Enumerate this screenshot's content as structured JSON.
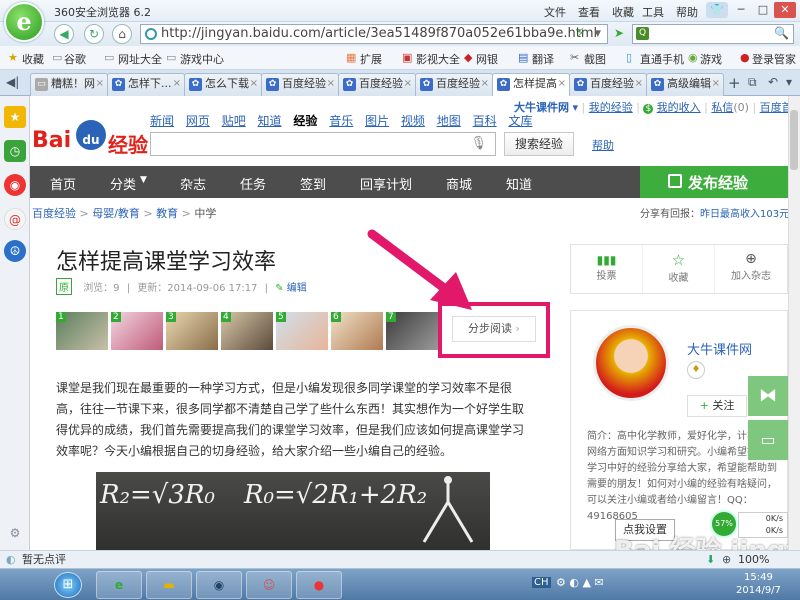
{
  "browser": {
    "title": "360安全浏览器 6.2",
    "menus": [
      "文件",
      "查看",
      "收藏",
      "工具",
      "帮助"
    ],
    "url": "http://jingyan.baidu.com/article/3ea51489f870a052e61bba9e.html",
    "favorites": [
      "收藏",
      "谷歌",
      "网址大全",
      "游戏中心"
    ],
    "toolbar_right": [
      "扩展",
      "影视大全",
      "网银",
      "翻译",
      "截图",
      "直通手机",
      "游戏",
      "登录管家"
    ],
    "tabs": [
      "糟糕！网",
      "怎样下...",
      "怎么下载",
      "百度经验",
      "百度经验",
      "百度经验",
      "怎样提高",
      "百度经验",
      "高级编辑"
    ],
    "status_text": "暂无点评",
    "zoom": "100%"
  },
  "site": {
    "logo_text": "Bai",
    "logo_du": "du",
    "logo_jy": "经验",
    "top_links": [
      "大牛课件网",
      "我的经验",
      "我的收入",
      "私信",
      "(0)",
      "百度首页"
    ],
    "search_nav": [
      "新闻",
      "网页",
      "贴吧",
      "知道",
      "经验",
      "音乐",
      "图片",
      "视频",
      "地图",
      "百科",
      "文库"
    ],
    "search_button": "搜索经验",
    "help": "帮助",
    "main_nav": [
      "首页",
      "分类",
      "杂志",
      "任务",
      "签到",
      "回享计划",
      "商城",
      "知道"
    ],
    "publish": "发布经验",
    "breadcrumb": [
      "百度经验",
      "母婴/教育",
      "教育",
      "中学"
    ],
    "share_note": "分享有回报：",
    "share_highlight": "昨日最高收入103元"
  },
  "article": {
    "title": "怎样提高课堂学习效率",
    "meta_tag": "原",
    "views": "浏览：9",
    "updated": "更新：2014-09-06 17:17",
    "edit": "编辑",
    "steps": [
      "1",
      "2",
      "3",
      "4",
      "5",
      "6",
      "7"
    ],
    "step_read": "分步阅读",
    "body": "课堂是我们现在最重要的一种学习方式，但是小编发现很多同学课堂的学习效率不是很高，往往一节课下来，很多同学都不清楚自己学了些什么东西！其实想作为一个好学生取得优异的成绩，我们首先需要提高我们的课堂学习效率，但是我们应该如何提高课堂学习效率呢？今天小编根据自己的切身经验，给大家介绍一些小编自己的经验。",
    "formula_a": "R₂=√3R₀",
    "formula_b": "R₀=√2R₁+2R₂"
  },
  "sidebar": {
    "actions": [
      "投票",
      "收藏",
      "加入杂志"
    ],
    "author": "大牛课件网",
    "follow": "关注",
    "bio": "简介：高中化学教师，爱好化学，计算机，网络方面知识学习和研究。小编希望把自己学习中好的经验分享给大家，希望能帮助到需要的朋友！如何对小编的经验有啥疑问，可以关注小编或者给小编留言！QQ：49168605",
    "like_btn": "点我设置"
  },
  "widget": {
    "percent": "57%",
    "up": "0K/s",
    "down": "0K/s"
  },
  "taskbar": {
    "lang": "CH",
    "time": "15:49",
    "date": "2014/9/7"
  },
  "watermark": "Bai 经验 jingyan.baidu.com",
  "colors": {
    "nav_bg": "#4d4d4d",
    "publish_bg": "#3dae3d",
    "link_blue": "#2b63b7",
    "highlight_pink": "#e2186a",
    "accent_red": "#e1221b"
  }
}
